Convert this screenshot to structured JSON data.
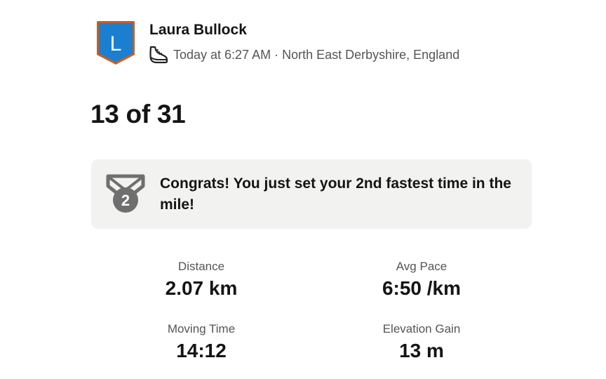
{
  "activity": {
    "athlete_name": "Laura Bullock",
    "avatar_initial": "L",
    "avatar_icon": "shield-badge-avatar",
    "activity_icon": "running-shoe-icon",
    "time": "Today at 6:27 AM",
    "separator": "·",
    "location": "North East Derbyshire, England"
  },
  "title": "13 of 31",
  "achievement": {
    "icon": "silver-medal-2-icon",
    "medal_number": "2",
    "text": "Congrats! You just set your 2nd fastest time in the mile!"
  },
  "stats": [
    {
      "label": "Distance",
      "value": "2.07 km"
    },
    {
      "label": "Avg Pace",
      "value": "6:50 /km"
    },
    {
      "label": "Moving Time",
      "value": "14:12"
    },
    {
      "label": "Elevation Gain",
      "value": "13 m"
    }
  ],
  "colors": {
    "avatar_blue": "#1a7fd0",
    "avatar_border": "#c0602a",
    "card_background": "#f2f2f0",
    "medal_gray": "#6f6f6f"
  }
}
